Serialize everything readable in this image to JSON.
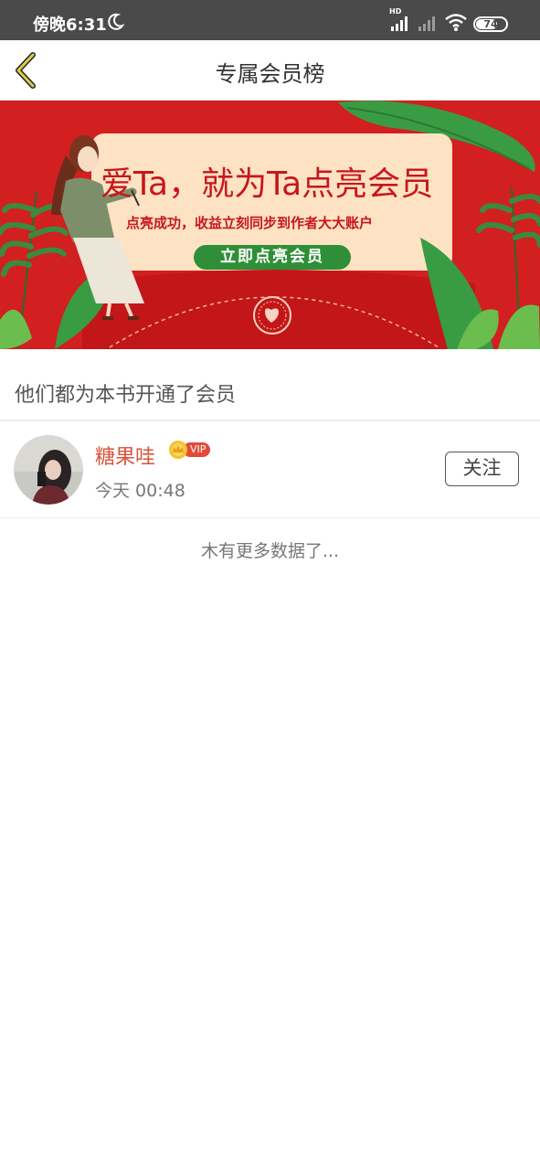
{
  "status_bar": {
    "time": "傍晚6:31",
    "hd": "HD",
    "battery": "74",
    "icons": [
      "moon-icon",
      "signal-icon",
      "signal-weak-icon",
      "wifi-icon",
      "battery-icon"
    ]
  },
  "header": {
    "title": "专属会员榜",
    "back_icon": "chevron-left-icon",
    "back_color": "#c9b23a"
  },
  "banner": {
    "headline": "爱Ta，就为Ta点亮会员",
    "subtitle": "点亮成功，收益立刻同步到作者大大账户",
    "button_label": "立即点亮会员",
    "colors": {
      "background": "#d21f1f",
      "card": "#fde3c3",
      "button": "#2f8f38",
      "text": "#c8161d"
    }
  },
  "section": {
    "title": "他们都为本书开通了会员"
  },
  "members": [
    {
      "name": "糖果哇",
      "badge": "VIP",
      "time": "今天 00:48",
      "follow_label": "关注"
    }
  ],
  "footer": {
    "no_more": "木有更多数据了..."
  }
}
